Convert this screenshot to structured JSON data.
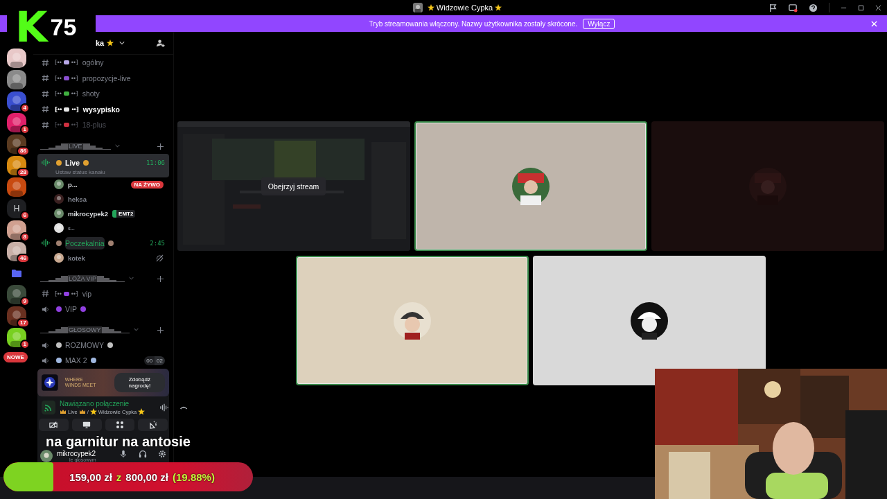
{
  "window": {
    "title": "Widzowie Cypka"
  },
  "logo": {
    "letter": "K",
    "number": "75"
  },
  "banner": {
    "text": "Tryb streamowania włączony. Nazwy użytkownika zostały skrócone.",
    "button": "Wyłącz"
  },
  "servers": [
    {
      "kind": "picture",
      "color": "#e8c8c8"
    },
    {
      "kind": "picture",
      "color": "#8a8a8a"
    },
    {
      "kind": "picture",
      "color": "#3a4fd0",
      "badge": "4"
    },
    {
      "kind": "picture",
      "color": "#e0206a",
      "badge": "1"
    },
    {
      "kind": "picture",
      "color": "#5a3a20",
      "badge": "86"
    },
    {
      "kind": "picture",
      "color": "#d88a10",
      "badge": "28"
    },
    {
      "kind": "picture",
      "color": "#c84a10"
    },
    {
      "kind": "letter",
      "label": "H",
      "badge": "6"
    },
    {
      "kind": "picture",
      "color": "#d0a090",
      "badge": "8"
    },
    {
      "kind": "picture",
      "color": "#c8b0a8",
      "badge": "46"
    },
    {
      "kind": "folder",
      "color": "#5865f2"
    },
    {
      "kind": "picture",
      "color": "#3a4a3a",
      "badge": "9"
    },
    {
      "kind": "picture",
      "color": "#6a3020",
      "badge": "17"
    },
    {
      "kind": "picture",
      "color": "#78d020",
      "badge": "1"
    }
  ],
  "new_badge": "NOWE",
  "server_header": {
    "name": "ka"
  },
  "channels": [
    {
      "kind": "text",
      "left": "⁅••",
      "right": "••⁆",
      "name": "ogólny",
      "color": "#b8a8e8",
      "unread": false,
      "muted": false
    },
    {
      "kind": "text",
      "left": "⁅••",
      "right": "••⁆",
      "name": "propozycje-live",
      "color": "#8a4fd0",
      "unread": false,
      "muted": false
    },
    {
      "kind": "text",
      "left": "⁅••",
      "right": "••⁆",
      "name": "shoty",
      "color": "#40b040",
      "unread": false,
      "muted": false
    },
    {
      "kind": "text",
      "left": "⁅••",
      "right": "••⁆",
      "name": "wysypisko",
      "color": "#e8e8e8",
      "unread": true,
      "muted": false
    },
    {
      "kind": "text",
      "left": "⁅••",
      "right": "••⁆",
      "name": "18-plus",
      "color": "#d03040",
      "unread": false,
      "muted": true
    },
    {
      "kind": "category",
      "name": "LIVE"
    },
    {
      "kind": "voice",
      "name": "Live",
      "color": "#e0a030",
      "selected": true,
      "active": false,
      "time": "11:06",
      "status": "Ustaw status kanału",
      "children": [
        {
          "name": "p...",
          "live": "NA ŻYWO",
          "dimmed": false,
          "small": false,
          "color": "#6a8a6a"
        },
        {
          "name": "heksa",
          "dimmed": true,
          "small": false,
          "color": "#3a2020"
        },
        {
          "name": "mikrocypek2",
          "tag": "EMT2",
          "dimmed": false,
          "small": false,
          "color": "#6a8a6a"
        },
        {
          "name": "s...",
          "dimmed": true,
          "small": true,
          "color": "#e0e0e0"
        }
      ]
    },
    {
      "kind": "voice",
      "name": "Poczekalnia",
      "color": "#a08070",
      "selected": false,
      "active": true,
      "time": "2:45",
      "children": [
        {
          "name": "kotek",
          "dimmed": true,
          "small": false,
          "deafened": true,
          "color": "#c8a890"
        }
      ]
    },
    {
      "kind": "category",
      "name": "LOŻA VIP"
    },
    {
      "kind": "text",
      "left": "⁅••",
      "right": "••⁆",
      "name": "vip",
      "color": "#9040e0",
      "unread": false,
      "muted": false
    },
    {
      "kind": "voice",
      "name": "VIP",
      "color": "#9040e0",
      "selected": false,
      "active": false
    },
    {
      "kind": "category",
      "name": "GŁOSOWY"
    },
    {
      "kind": "voice",
      "name": "ROZMOWY",
      "color": "#c0c0c0",
      "selected": false,
      "active": false
    },
    {
      "kind": "voice",
      "name": "MAX 2",
      "color": "#a0b8e0",
      "selected": false,
      "active": false,
      "counts": [
        "00",
        "02"
      ]
    }
  ],
  "voice_panel": {
    "brand": "WHERE WINDS MEET",
    "promo_button": "Zdobądź nagrodę!",
    "status": "Nawiązano połączenie",
    "channel": "Live",
    "separator": "/",
    "server": "Widzowie Cypka"
  },
  "user": {
    "name": "mikrocypek2",
    "status": "le głosowym"
  },
  "tiles": [
    {
      "kind": "stream",
      "button": "Obejrzyj stream",
      "speaking": false,
      "color": "#1e1f22"
    },
    {
      "kind": "user",
      "speaking": true,
      "color": "#bfb5ab"
    },
    {
      "kind": "user",
      "speaking": false,
      "color": "#1a0d0d"
    },
    {
      "kind": "user",
      "speaking": true,
      "color": "#ddd1bc"
    },
    {
      "kind": "user",
      "speaking": false,
      "color": "#d9d9d9"
    }
  ],
  "caption": "na garnitur na antosie",
  "goal": {
    "raised": "159,00 zł",
    "joiner": "z",
    "target": "800,00 zł",
    "percent": "(19.88%)",
    "level": 0.1988
  }
}
